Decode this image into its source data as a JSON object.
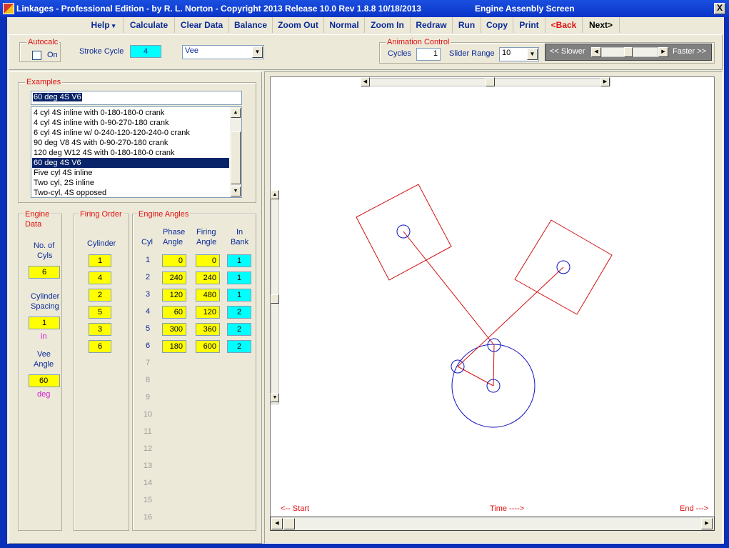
{
  "window": {
    "title": "Linkages - Professional Edition - by R. L. Norton - Copyright 2013   Release 10.0   Rev 1.8.8   10/18/2013",
    "screen_title": "Engine Assenbly Screen",
    "close_label": "X"
  },
  "menu": {
    "help": "Help",
    "help_arrow": "▾",
    "calculate": "Calculate",
    "clear_data": "Clear Data",
    "balance": "Balance",
    "zoom_out": "Zoom Out",
    "normal": "Normal",
    "zoom_in": "Zoom In",
    "redraw": "Redraw",
    "run": "Run",
    "copy": "Copy",
    "print": "Print",
    "back": "<Back",
    "next": "Next>"
  },
  "toolbar": {
    "autocalc_label": "Autocalc",
    "autocalc_on_label": "On",
    "autocalc_checked": false,
    "stroke_cycle_label": "Stroke Cycle",
    "stroke_cycle_value": "4",
    "engine_type_value": "Vee",
    "animation_label": "Animation Control",
    "cycles_label": "Cycles",
    "cycles_value": "1",
    "slider_range_label": "Slider Range",
    "slider_range_value": "10",
    "slower_label": "<< Slower",
    "faster_label": "Faster >>"
  },
  "examples": {
    "label": "Examples",
    "selected_text": "60 deg  4S V6",
    "items": [
      "4 cyl 4S inline with 0-180-180-0 crank",
      "4 cyl 4S inline with 0-90-270-180 crank",
      "6 cyl 4S inline w/ 0-240-120-120-240-0 crank",
      "90 deg V8 4S with 0-90-270-180 crank",
      "120 deg W12 4S with 0-180-180-0 crank",
      "60 deg  4S V6",
      "Five cyl 4S inline",
      "Two cyl, 2S inline",
      "Two-cyl, 4S opposed"
    ],
    "selected_index": 5
  },
  "engine_data": {
    "label_line1": "Engine",
    "label_line2": "Data",
    "num_cyls_label_1": "No. of",
    "num_cyls_label_2": "Cyls",
    "num_cyls": "6",
    "spacing_label_1": "Cylinder",
    "spacing_label_2": "Spacing",
    "spacing": "1",
    "spacing_unit": "in",
    "vee_label_1": "Vee",
    "vee_label_2": "Angle",
    "vee_angle": "60",
    "vee_unit": "deg"
  },
  "firing_order": {
    "label": "Firing Order",
    "column_label": "Cylinder",
    "values": [
      "1",
      "4",
      "2",
      "5",
      "3",
      "6"
    ]
  },
  "engine_angles": {
    "label": "Engine Angles",
    "cyl_header": "Cyl",
    "phase_header_1": "Phase",
    "phase_header_2": "Angle",
    "firing_header_1": "Firing",
    "firing_header_2": "Angle",
    "bank_header_1": "In",
    "bank_header_2": "Bank",
    "rows": [
      {
        "cyl": "1",
        "phase": "0",
        "firing": "0",
        "bank": "1"
      },
      {
        "cyl": "2",
        "phase": "240",
        "firing": "240",
        "bank": "1"
      },
      {
        "cyl": "3",
        "phase": "120",
        "firing": "480",
        "bank": "1"
      },
      {
        "cyl": "4",
        "phase": "60",
        "firing": "120",
        "bank": "2"
      },
      {
        "cyl": "5",
        "phase": "300",
        "firing": "360",
        "bank": "2"
      },
      {
        "cyl": "6",
        "phase": "180",
        "firing": "600",
        "bank": "2"
      }
    ],
    "inactive_cyls": [
      "7",
      "8",
      "9",
      "10",
      "11",
      "12",
      "13",
      "14",
      "15",
      "16"
    ]
  },
  "canvas": {
    "start_label": "<-- Start",
    "time_label": "Time ---->",
    "end_label": "End --->",
    "colors": {
      "cylinder": "#d01010",
      "crank": "#1010c0"
    }
  }
}
